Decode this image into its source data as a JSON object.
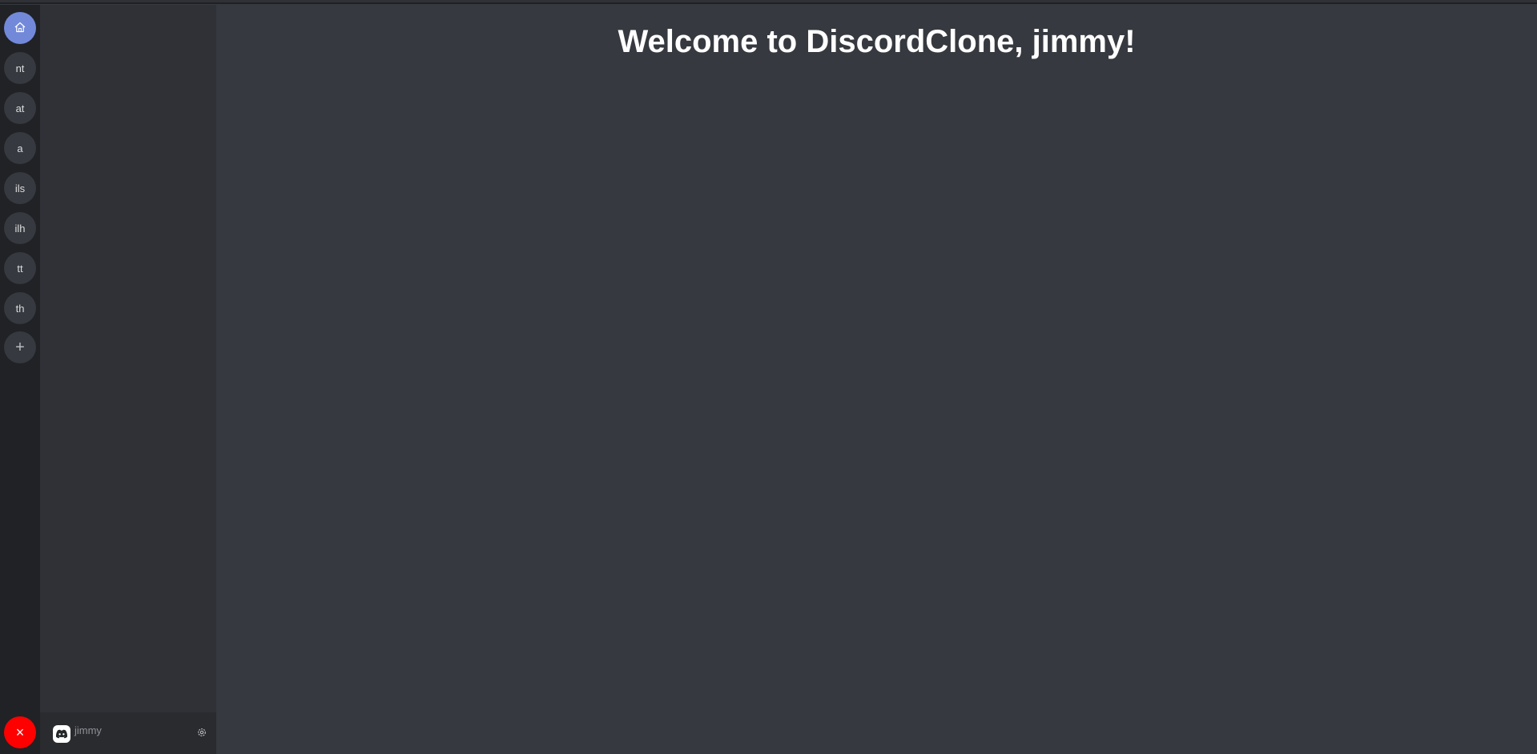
{
  "servers": {
    "home_icon": "home-icon",
    "items": [
      {
        "label": "nt"
      },
      {
        "label": "at"
      },
      {
        "label": "a"
      },
      {
        "label": "ils"
      },
      {
        "label": "ilh"
      },
      {
        "label": "tt"
      },
      {
        "label": "th"
      }
    ],
    "add_label": "+",
    "logout_label": "×"
  },
  "user": {
    "name": "jimmy",
    "avatar_icon": "discord-logo-icon",
    "settings_icon": "gear-icon"
  },
  "main": {
    "welcome": "Welcome to DiscordClone, jimmy!"
  },
  "colors": {
    "rail": "#202225",
    "channel_column": "#2f3136",
    "main": "#36393f",
    "home_accent": "#7289da",
    "logout": "#ff0000"
  }
}
